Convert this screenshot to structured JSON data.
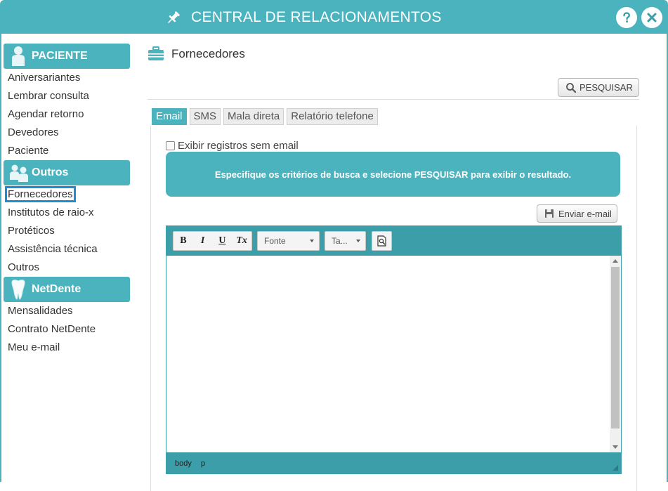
{
  "app": {
    "title": "CENTRAL DE RELACIONAMENTOS"
  },
  "colors": {
    "accent": "#4bb3be",
    "accent_dark": "#3c9ea8",
    "active_outline": "#1a8ed1"
  },
  "sidebar": {
    "sections": [
      {
        "label": "PACIENTE",
        "icon": "patient-icon",
        "items": [
          "Aniversariantes",
          "Lembrar consulta",
          "Agendar retorno",
          "Devedores",
          "Paciente"
        ]
      },
      {
        "label": "Outros",
        "icon": "people-icon",
        "items": [
          "Fornecedores",
          "Institutos de raio-x",
          "Protéticos",
          "Assistência técnica",
          "Outros"
        ]
      },
      {
        "label": "NetDente",
        "icon": "tooth-icon",
        "items": [
          "Mensalidades",
          "Contrato NetDente",
          "Meu e-mail"
        ]
      }
    ],
    "active_item": "Fornecedores"
  },
  "main": {
    "heading": "Fornecedores",
    "search_button": "PESQUISAR",
    "tabs": [
      "Email",
      "SMS",
      "Mala direta",
      "Relatório telefone"
    ],
    "active_tab": "Email",
    "checkbox_label": "Exibir registros sem email",
    "checkbox_checked": false,
    "info_message": "Especifique os critérios de busca e selecione PESQUISAR para exibir o resultado.",
    "send_button": "Enviar e-mail"
  },
  "editor": {
    "format_buttons": [
      "B",
      "I",
      "U",
      "Tx"
    ],
    "font_dropdown": "Fonte",
    "size_dropdown": "Ta...",
    "path": [
      "body",
      "p"
    ]
  }
}
